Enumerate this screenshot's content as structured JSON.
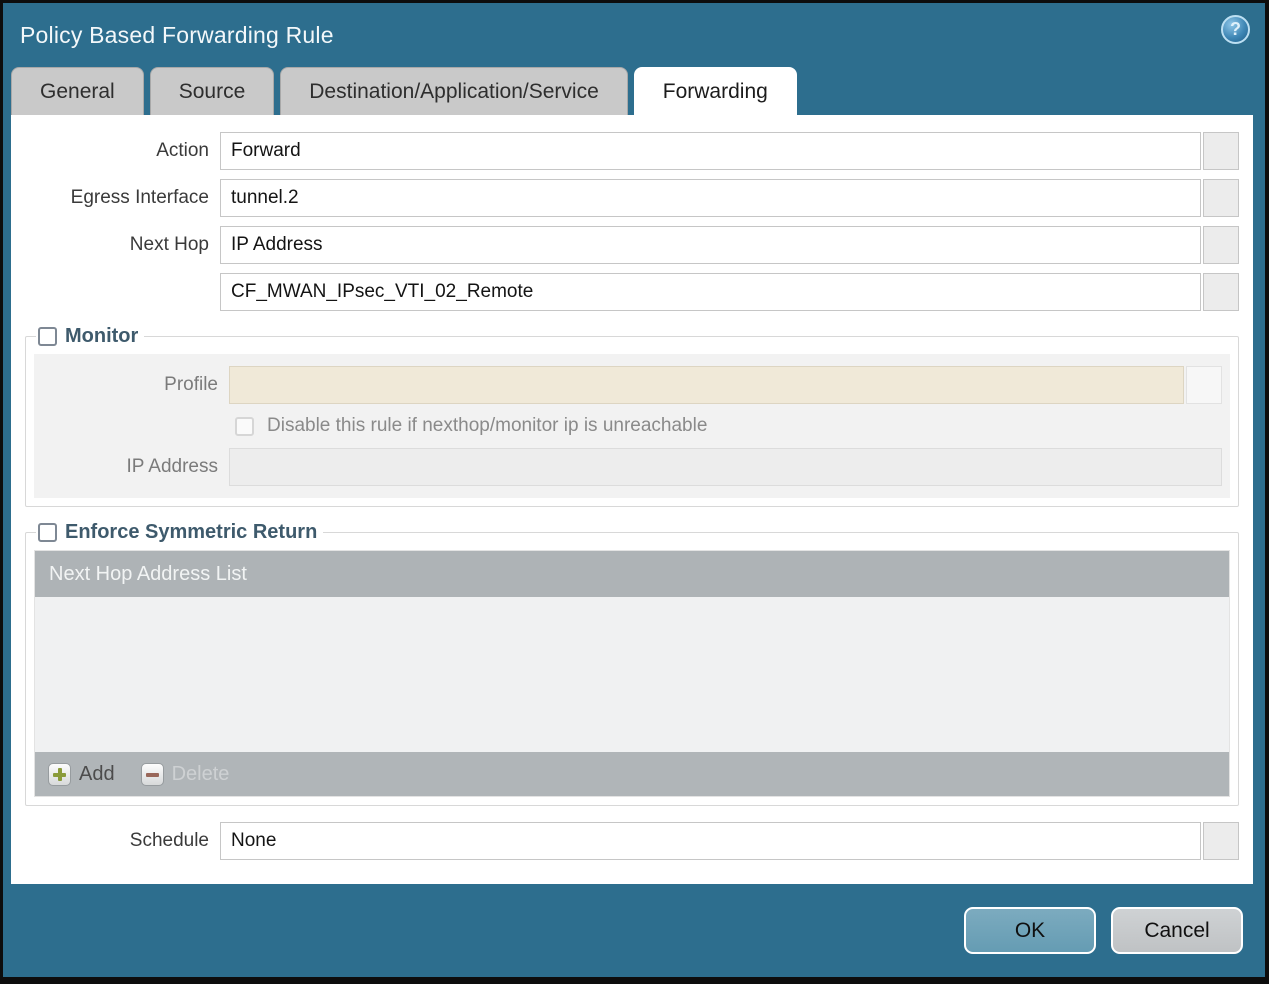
{
  "dialog": {
    "title": "Policy Based Forwarding Rule"
  },
  "tabs": [
    {
      "label": "General",
      "active": false
    },
    {
      "label": "Source",
      "active": false
    },
    {
      "label": "Destination/Application/Service",
      "active": false
    },
    {
      "label": "Forwarding",
      "active": true
    }
  ],
  "form": {
    "action": {
      "label": "Action",
      "value": "Forward"
    },
    "egress_interface": {
      "label": "Egress Interface",
      "value": "tunnel.2"
    },
    "next_hop": {
      "label": "Next Hop",
      "value": "IP Address"
    },
    "next_hop_address": {
      "value": "CF_MWAN_IPsec_VTI_02_Remote"
    },
    "schedule": {
      "label": "Schedule",
      "value": "None"
    }
  },
  "monitor": {
    "title": "Monitor",
    "checked": false,
    "profile": {
      "label": "Profile",
      "value": ""
    },
    "disable_rule": {
      "label": "Disable this rule if nexthop/monitor ip is unreachable",
      "checked": false
    },
    "ip_address": {
      "label": "IP Address",
      "value": ""
    }
  },
  "symmetric_return": {
    "title": "Enforce Symmetric Return",
    "checked": false,
    "table": {
      "header": "Next Hop Address List",
      "rows": []
    },
    "add_label": "Add",
    "delete_label": "Delete"
  },
  "footer": {
    "ok_label": "OK",
    "cancel_label": "Cancel"
  },
  "colors": {
    "titlebar_bg": "#2d6e8e",
    "tab_inactive_bg": "#c9c9c9",
    "table_header_bg": "#aeb3b6",
    "disabled_field_bg": "#f0e9d8",
    "ok_button_bg": "#6fa4ba",
    "cancel_button_bg": "#c6c9cb",
    "add_icon_green": "#8a9b3a",
    "delete_icon_red": "#99675a"
  }
}
